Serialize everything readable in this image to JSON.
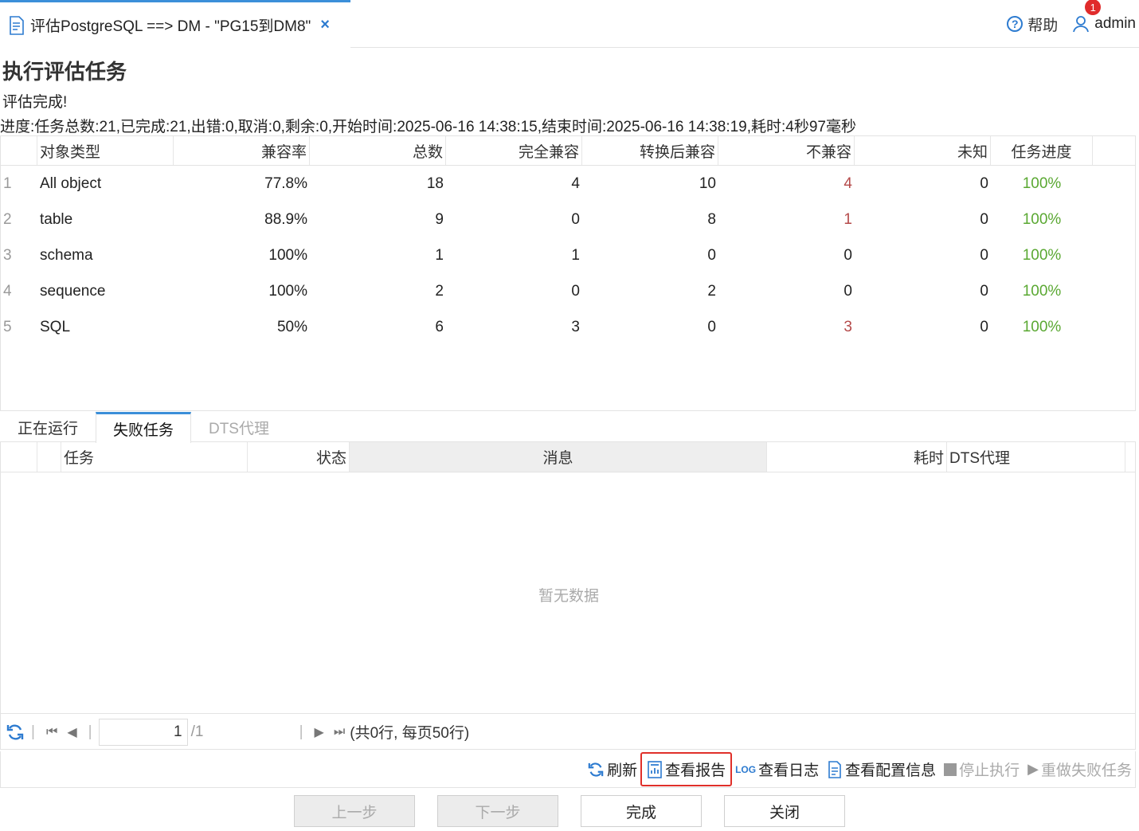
{
  "tab": {
    "title": "评估PostgreSQL ==> DM - \"PG15到DM8\"",
    "close": "×"
  },
  "header": {
    "help_label": "帮助",
    "user_name": "admin",
    "notification_count": "1"
  },
  "page": {
    "title": "执行评估任务",
    "status": "评估完成!",
    "progress": "进度:任务总数:21,已完成:21,出错:0,取消:0,剩余:0,开始时间:2025-06-16 14:38:15,结束时间:2025-06-16 14:38:19,耗时:4秒97毫秒"
  },
  "summary": {
    "columns": [
      "对象类型",
      "兼容率",
      "总数",
      "完全兼容",
      "转换后兼容",
      "不兼容",
      "未知",
      "任务进度"
    ],
    "rows": [
      {
        "idx": "1",
        "type": "All object",
        "rate": "77.8%",
        "total": "18",
        "full": "4",
        "conv": "10",
        "inc": "4",
        "unk": "0",
        "prog": "100%"
      },
      {
        "idx": "2",
        "type": "table",
        "rate": "88.9%",
        "total": "9",
        "full": "0",
        "conv": "8",
        "inc": "1",
        "unk": "0",
        "prog": "100%"
      },
      {
        "idx": "3",
        "type": "schema",
        "rate": "100%",
        "total": "1",
        "full": "1",
        "conv": "0",
        "inc": "0",
        "unk": "0",
        "prog": "100%"
      },
      {
        "idx": "4",
        "type": "sequence",
        "rate": "100%",
        "total": "2",
        "full": "0",
        "conv": "2",
        "inc": "0",
        "unk": "0",
        "prog": "100%"
      },
      {
        "idx": "5",
        "type": "SQL",
        "rate": "50%",
        "total": "6",
        "full": "3",
        "conv": "0",
        "inc": "3",
        "unk": "0",
        "prog": "100%"
      }
    ]
  },
  "tabs": [
    {
      "label": "正在运行",
      "state": "normal"
    },
    {
      "label": "失败任务",
      "state": "active"
    },
    {
      "label": "DTS代理",
      "state": "disabled"
    }
  ],
  "failed": {
    "columns": [
      "任务",
      "状态",
      "消息",
      "耗时",
      "DTS代理"
    ],
    "empty_text": "暂无数据"
  },
  "pager": {
    "page": "1",
    "total_pages": "/1",
    "summary": "(共0行, 每页50行)"
  },
  "actions": {
    "refresh": "刷新",
    "view_report": "查看报告",
    "view_log": "查看日志",
    "view_config": "查看配置信息",
    "stop": "停止执行",
    "redo": "重做失败任务"
  },
  "buttons": {
    "prev": "上一步",
    "next": "下一步",
    "finish": "完成",
    "close": "关闭"
  },
  "colors": {
    "accent": "#3b8fd9",
    "incompatible": "#b54a4a",
    "progress": "#5aa832",
    "highlight": "#e0302a"
  }
}
